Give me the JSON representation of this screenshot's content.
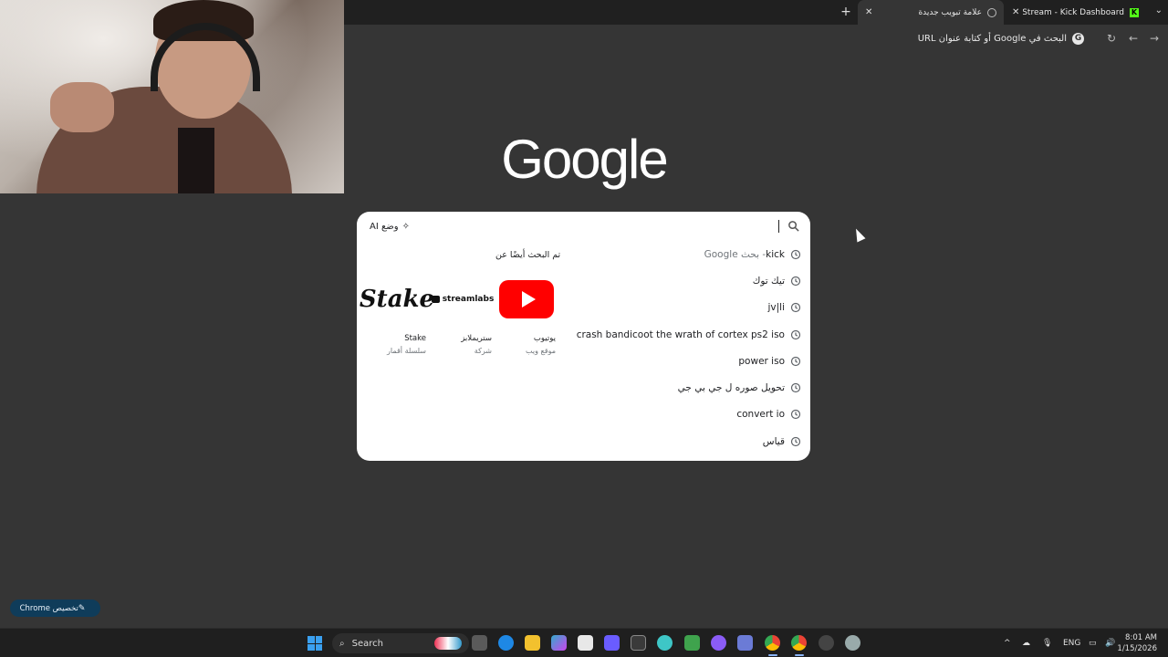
{
  "browser": {
    "tabs": [
      {
        "label": "علامة تبويب جديدة",
        "active": true,
        "icon": "chrome-icon"
      },
      {
        "label": "Stream - Kick Dashboard",
        "active": false,
        "icon": "kick-icon"
      }
    ],
    "new_tab_icon": "plus-icon",
    "omnibox_placeholder": "البحث في Google أو كتابة عنوان URL"
  },
  "page": {
    "logo_text": "Google",
    "search": {
      "ai_mode_label": "وضع AI",
      "suggestions": [
        {
          "text": "kick",
          "suffix": " - بحث Google"
        },
        {
          "text": "تيك توك"
        },
        {
          "text": "jv|li"
        },
        {
          "text": "crash bandicoot the wrath of cortex ps2 iso"
        },
        {
          "text": "power iso"
        },
        {
          "text": "تحويل صوره ل جي بي جي"
        },
        {
          "text": "convert io"
        },
        {
          "text": "قياس"
        }
      ],
      "also_searched": {
        "title": "تم البحث أيضًا عن",
        "entities": [
          {
            "name": "يوتيوب",
            "type": "موقع ويب",
            "logo": "youtube-logo"
          },
          {
            "name": "ستريملابز",
            "type": "شركة",
            "logo": "streamlabs-logo",
            "logo_text": "streamlabs"
          },
          {
            "name": "Stake",
            "type": "سلسلة أقمار",
            "logo": "stake-logo",
            "logo_text": "Stake"
          }
        ]
      }
    },
    "customize_label": "تخصيص Chrome"
  },
  "taskbar": {
    "search_label": "Search",
    "language": "ENG",
    "time": "8:01 AM",
    "date": "1/15/2026"
  },
  "colors": {
    "background": "#353535",
    "tabstrip": "#202020",
    "youtube_red": "#ff0000",
    "accent": "#8ab4f8"
  }
}
